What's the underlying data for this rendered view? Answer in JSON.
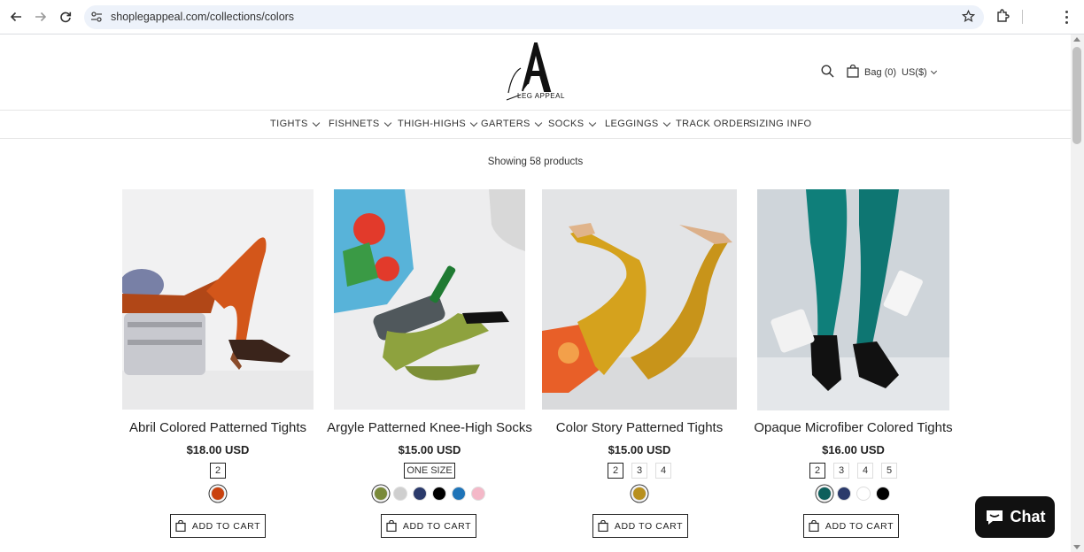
{
  "browser": {
    "url": "shoplegappeal.com/collections/colors",
    "icons": [
      "back-icon",
      "forward-icon",
      "reload-icon",
      "site-settings-icon",
      "bookmark-star-icon",
      "extensions-icon",
      "more-menu-icon"
    ]
  },
  "header": {
    "logo_text": "LEG APPEAL",
    "bag_label": "Bag (0)",
    "currency": "US($)"
  },
  "nav": {
    "items": [
      {
        "label": "TIGHTS",
        "dropdown": true
      },
      {
        "label": "FISHNETS",
        "dropdown": true
      },
      {
        "label": "THIGH-HIGHS",
        "dropdown": true
      },
      {
        "label": "GARTERS",
        "dropdown": true
      },
      {
        "label": "SOCKS",
        "dropdown": true
      },
      {
        "label": "LEGGINGS",
        "dropdown": true
      },
      {
        "label": "TRACK ORDER",
        "dropdown": false
      },
      {
        "label": "SIZING INFO",
        "dropdown": false
      }
    ]
  },
  "collection": {
    "count_text": "Showing 58 products"
  },
  "products": [
    {
      "title": "Abril Colored Patterned Tights",
      "price": "$18.00 USD",
      "sizes": [
        "2"
      ],
      "selected_size": 0,
      "swatches": [
        "#c9420f"
      ],
      "selected_swatch": 0,
      "add_label": "ADD TO CART"
    },
    {
      "title": "Argyle Patterned Knee-High Socks",
      "price": "$15.00 USD",
      "sizes": [
        "ONE SIZE"
      ],
      "selected_size": 0,
      "swatches": [
        "#7a8a3a",
        "#cfcfcf",
        "#2b3a6b",
        "#000000",
        "#1f74b8",
        "#f4b8c8"
      ],
      "selected_swatch": 0,
      "add_label": "ADD TO CART"
    },
    {
      "title": "Color Story Patterned Tights",
      "price": "$15.00 USD",
      "sizes": [
        "2",
        "3",
        "4"
      ],
      "selected_size": 0,
      "swatches": [
        "#b8901e"
      ],
      "selected_swatch": 0,
      "add_label": "ADD TO CART"
    },
    {
      "title": "Opaque Microfiber Colored Tights",
      "price": "$16.00 USD",
      "sizes": [
        "2",
        "3",
        "4",
        "5"
      ],
      "selected_size": 0,
      "swatches": [
        "#0d5f5c",
        "#2b3a6b",
        "#ffffff",
        "#000000"
      ],
      "selected_swatch": 0,
      "add_label": "ADD TO CART"
    }
  ],
  "chat": {
    "label": "Chat"
  }
}
